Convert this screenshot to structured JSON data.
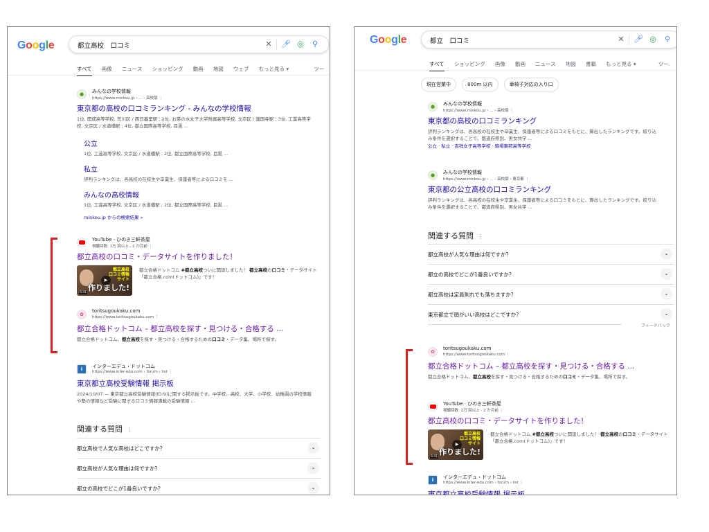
{
  "colors": {
    "link": "#1a0dab",
    "visited": "#681da8",
    "bracket": "#e02020"
  },
  "left": {
    "logo": [
      "G",
      "o",
      "o",
      "g",
      "l",
      "e"
    ],
    "query": "都立高校　口コミ",
    "icons": {
      "clear": "close-icon",
      "voice": "mic-icon",
      "lens": "lens-icon",
      "search": "search-icon"
    },
    "tabs": [
      "すべて",
      "画像",
      "ニュース",
      "ショッピング",
      "動画",
      "地図",
      "ウェブ",
      "もっと見る ▾",
      "ツー"
    ],
    "results": [
      {
        "site": "みんなの学校情報",
        "url": "https://www.minkou.jp › ... › 高校版  ⋮",
        "title": "東京都の高校の口コミランキング - みんなの学校情報",
        "snippet": "1位, 開成高等学校, 荒川区 / 西日暮里駅 ; 2位, お茶の水女子大学附属高等学校, 文京区 / 護国寺駅 ; 3位, 工業高等学校, 文京区 / 水道橋駅 ; 4位, 都立国際高等学校, 目黒 ..."
      }
    ],
    "sitelinks": [
      {
        "title": "公立",
        "snippet": "1位, 工芸高等学校, 文京区 / 水道橋駅 ; 2位, 都立国際高等学校, 目黒 ..."
      },
      {
        "title": "私立",
        "snippet": "評判ランキングは、各高校の在校生や卒業生、保護者等による口コミを ..."
      },
      {
        "title": "みんなの高校情報",
        "snippet": "1位, 工芸高等学校, 文京区 / 水道橋駅 ; 2位, 都立国際高等学校, 目黒 ..."
      }
    ],
    "more_from_site": "minkou.jp からの検索結果 »",
    "youtube": {
      "site": "YouTube · ひのき三軒茶屋",
      "url": "視聴回数: 1万 回以上 · 2 か月前  ⋮",
      "title": "都立高校の口コミ・データサイトを作りました！",
      "snippet_pre": "都立合格ドットコム ",
      "snippet_b1": "#都立高校",
      "snippet_mid": "ついに開設しました！ ",
      "snippet_b2": "都立高校",
      "snippet_mid2": "の",
      "snippet_b3": "口コミ",
      "snippet_post": "・データサイト「都立合格.com(ドットコム)」です！",
      "thumb_top": "都立高校\n口コミ情報\nサイト",
      "thumb_main": "作りました!",
      "thumb_badge": "6:41"
    },
    "toritsu": {
      "site": "toritsugoukaku.com",
      "url": "https://www.toritsugoukaku.com  ⋮",
      "title": "都立合格ドットコム – 都立高校を探す・見つける・合格する ...",
      "snippet_pre": "都立合格ドットコム、",
      "snippet_b1": "都立高校",
      "snippet_mid": "を探す・見つける・合格するための",
      "snippet_b2": "口コミ",
      "snippet_post": "・データ集、場所で探す。"
    },
    "interedu": {
      "site": "インターエデュ・ドットコム",
      "url": "https://www.inter-edu.com › forum › list  ⋮",
      "title": "東京都立高校受験情報 掲示板",
      "snippet": "2024/10/07 — 東京都立高校受験情報(ID:9)に関する掲示板です。中学校、高校、大学、小学校、幼稚園の学校情報や塾の情報など受験に関する口コミ情報満載の受験情報 ..."
    },
    "paa": {
      "title": "関連する質問",
      "questions": [
        "都立高校で人気な高校はどこですか？",
        "都立高校が人気な理由は何ですか？",
        "都立の高校でどこが1番良いですか？"
      ]
    }
  },
  "right": {
    "query": "都立　口コミ",
    "tabs": [
      "すべて",
      "ショッピング",
      "画像",
      "動画",
      "ニュース",
      "地図",
      "書籍",
      "もっと見る ▾",
      "ツー"
    ],
    "chips": [
      "現在営業中",
      "800m 以内",
      "車椅子対応の入り口"
    ],
    "minkou1": {
      "site": "みんなの学校情報",
      "url": "https://www.minkou.jp › ... › 高校版  ⋮",
      "title": "東京都の高校の口コミランキング",
      "snippet": "評判ランキングは、各高校の在校生や卒業生、保護者等による口コミをもとに、算出したランキングです。絞り込み条件を選択することで、都道府県別、男女共学 ...",
      "links": "公立 · 私立 · 吉祥女子高等学校 · 駒場東邦高等学校"
    },
    "minkou2": {
      "site": "みんなの学校情報",
      "url": "https://www.minkou.jp › ... › 高校版 › 東京都  ⋮",
      "title": "東京都の公立高校の口コミランキング",
      "snippet": "評判ランキングは、各高校の在校生や卒業生、保護者等による口コミをもとに、算出したランキングです。絞り込み条件を選択することで、都道府県別、男女共学 ..."
    },
    "paa": {
      "title": "関連する質問",
      "questions": [
        "都立高校が人気な理由は何ですか？",
        "都立の高校でどこが1番良いですか？",
        "都立高校は定員割れでも落ちますか？",
        "東京都立で頭がいい高校はどこですか？"
      ],
      "feedback": "フィードバック"
    },
    "interedu": {
      "site": "インターエデュ・ドットコム",
      "url": "https://www.inter-edu.com › forum › list  ⋮",
      "title": "東京都立高校受験情報 掲示板"
    }
  }
}
